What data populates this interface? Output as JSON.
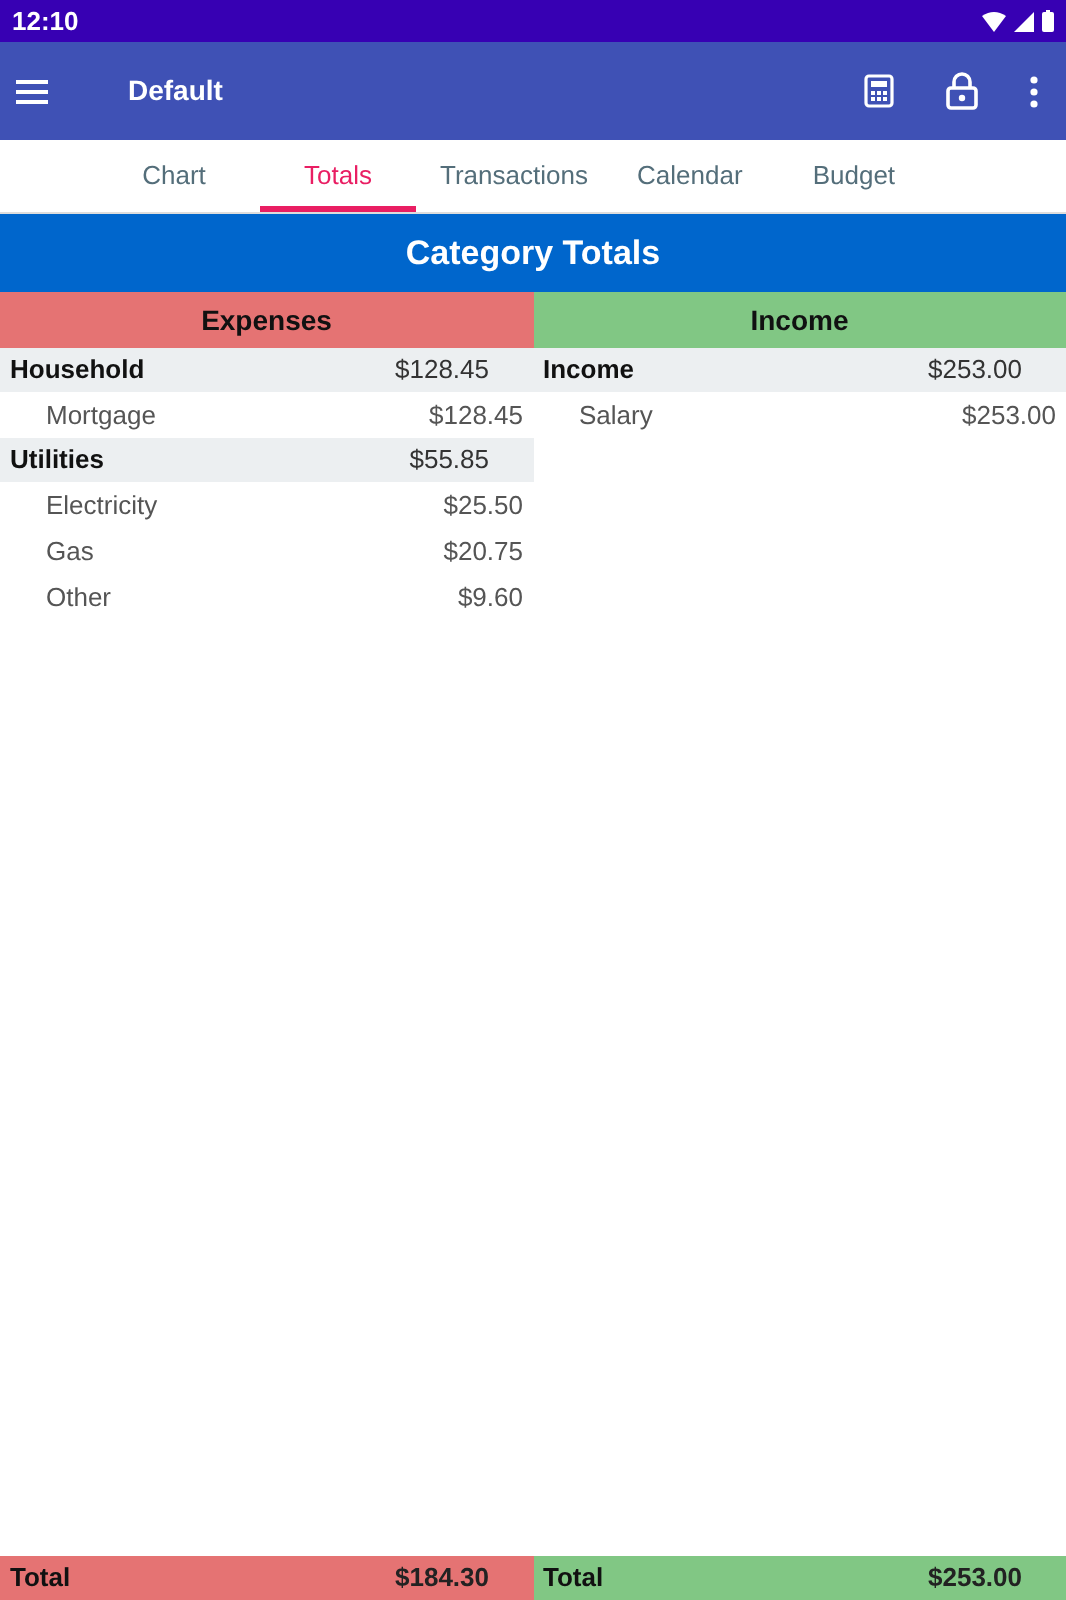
{
  "status_bar": {
    "time": "12:10"
  },
  "app_bar": {
    "title": "Default"
  },
  "tabs": [
    {
      "label": "Chart",
      "selected": false
    },
    {
      "label": "Totals",
      "selected": true
    },
    {
      "label": "Transactions",
      "selected": false
    },
    {
      "label": "Calendar",
      "selected": false
    },
    {
      "label": "Budget",
      "selected": false
    }
  ],
  "heading": "Category Totals",
  "columns": [
    {
      "title": "Expenses",
      "color": "#e57373",
      "categories": [
        {
          "name": "Household",
          "amount": "$128.45",
          "children": [
            {
              "name": "Mortgage",
              "amount": "$128.45"
            }
          ]
        },
        {
          "name": "Utilities",
          "amount": "$55.85",
          "children": [
            {
              "name": "Electricity",
              "amount": "$25.50"
            },
            {
              "name": "Gas",
              "amount": "$20.75"
            },
            {
              "name": "Other",
              "amount": "$9.60"
            }
          ]
        }
      ],
      "total": {
        "label": "Total",
        "amount": "$184.30"
      }
    },
    {
      "title": "Income",
      "color": "#81c784",
      "categories": [
        {
          "name": "Income",
          "amount": "$253.00",
          "children": [
            {
              "name": "Salary",
              "amount": "$253.00"
            }
          ]
        }
      ],
      "total": {
        "label": "Total",
        "amount": "$253.00"
      }
    }
  ]
}
